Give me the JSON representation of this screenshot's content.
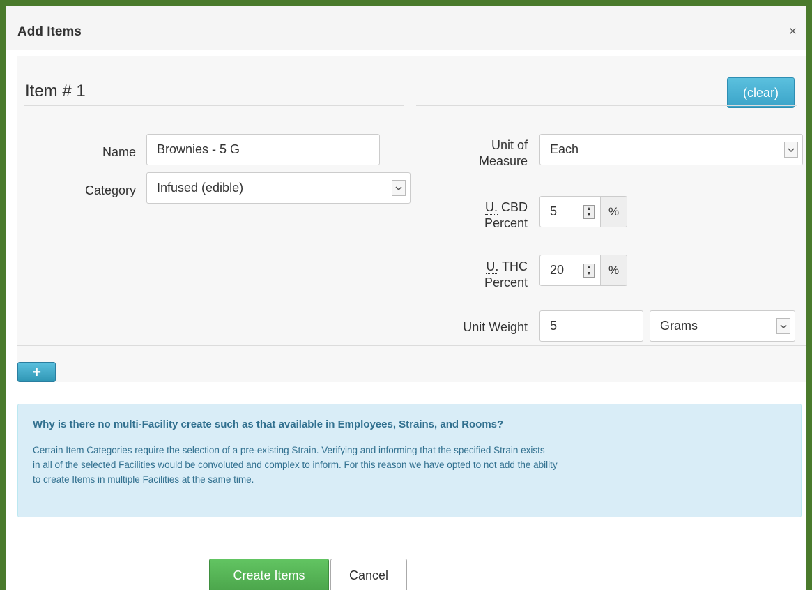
{
  "dialog": {
    "title": "Add Items",
    "close_glyph": "×"
  },
  "item": {
    "heading": "Item # 1",
    "clear_label": "(clear)",
    "add_glyph": "+"
  },
  "fields": {
    "name": {
      "label": "Name",
      "value": "Brownies - 5 G"
    },
    "category": {
      "label": "Category",
      "value": "Infused (edible)"
    },
    "unit_of_measure": {
      "label_line1": "Unit of",
      "label_line2": "Measure",
      "value": "Each"
    },
    "cbd": {
      "label_abbr": "U.",
      "label_rest": " CBD",
      "label_line2": "Percent",
      "value": "5",
      "addon": "%"
    },
    "thc": {
      "label_abbr": "U.",
      "label_rest": " THC",
      "label_line2": "Percent",
      "value": "20",
      "addon": "%"
    },
    "unit_weight": {
      "label": "Unit Weight",
      "value": "5",
      "unit": "Grams"
    }
  },
  "info": {
    "title": "Why is there no multi-Facility create such as that available in Employees, Strains, and Rooms?",
    "line1": "Certain Item Categories require the selection of a pre-existing Strain. Verifying and informing that the specified Strain exists",
    "line2": "in all of the selected Facilities would be convoluted and complex to inform. For this reason we have opted to not add the ability",
    "line3": "to create Items in multiple Facilities at the same time."
  },
  "footer": {
    "create_label": "Create Items",
    "cancel_label": "Cancel"
  },
  "icons": {
    "close": "close-icon",
    "select_arrow": "chevron-down-icon",
    "stepper": "spinner-icon",
    "add": "plus-icon"
  },
  "colors": {
    "frame_green": "#4a7a2c",
    "info_button": "#5bc0de",
    "success_button": "#5cb85c",
    "alert_bg": "#d9edf7",
    "alert_text": "#31708f"
  }
}
